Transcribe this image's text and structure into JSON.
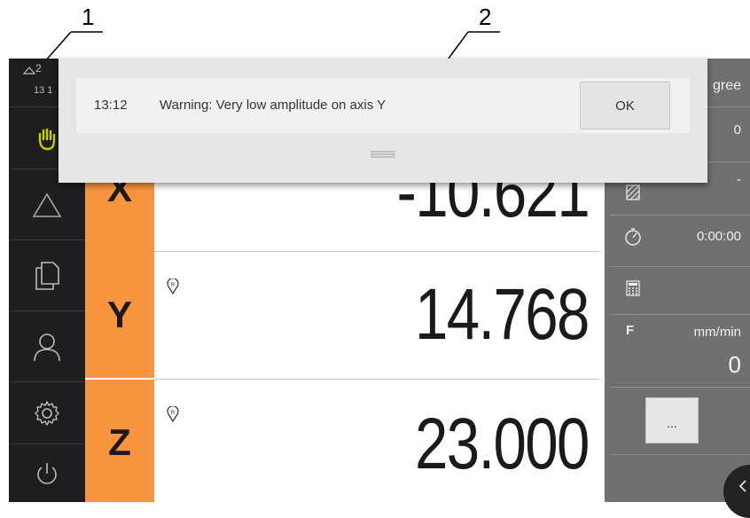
{
  "callouts": {
    "one": "1",
    "two": "2"
  },
  "status": {
    "line1": "2",
    "line2": "13 1"
  },
  "axes": [
    {
      "label": "X",
      "value": "-10.621"
    },
    {
      "label": "Y",
      "value": "14.768"
    },
    {
      "label": "Z",
      "value": "23.000"
    }
  ],
  "right_panel": {
    "unit_top": "gree",
    "row1_value": "0",
    "row2_value": "-",
    "timer_value": "0:00:00",
    "feed_label": "F",
    "feed_unit": "mm/min",
    "feed_value": "0",
    "more_label": "..."
  },
  "dialog": {
    "time": "13:12",
    "message": "Warning: Very low amplitude on axis Y",
    "ok_label": "OK"
  },
  "colors": {
    "axis_accent": "#f7943d",
    "sidebar_bg": "#1e1e1e",
    "hand_icon": "#c9d000"
  }
}
